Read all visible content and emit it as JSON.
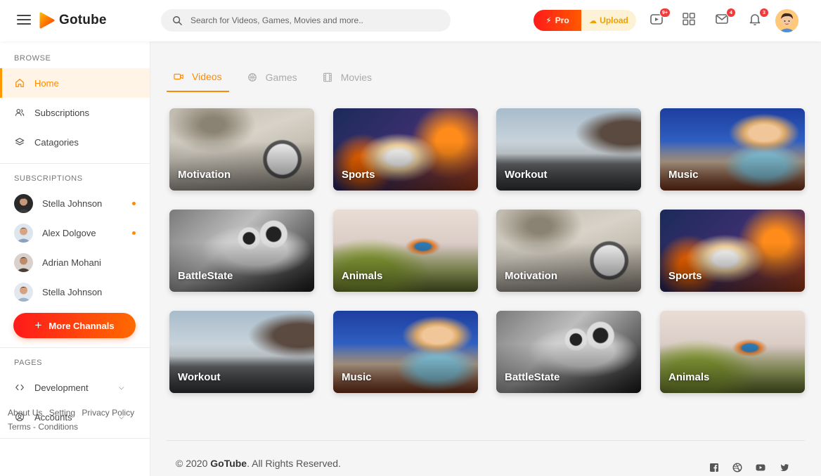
{
  "header": {
    "logo_text": "Gotube",
    "search_placeholder": "Search for Videos, Games, Movies and more..",
    "pro_label": "Pro",
    "upload_label": "Upload",
    "badges": {
      "video": "9+",
      "mail": "4",
      "notifications": "3"
    }
  },
  "sidebar": {
    "browse_title": "BROWSE",
    "browse": [
      {
        "label": "Home",
        "icon": "home-icon"
      },
      {
        "label": "Subscriptions",
        "icon": "users-icon"
      },
      {
        "label": "Catagories",
        "icon": "layers-icon"
      }
    ],
    "subscriptions_title": "SUBSCRIPTIONS",
    "subscriptions": [
      {
        "name": "Stella Johnson",
        "has_dot": true
      },
      {
        "name": "Alex Dolgove",
        "has_dot": true
      },
      {
        "name": "Adrian Mohani",
        "has_dot": false
      },
      {
        "name": "Stella Johnson",
        "has_dot": false
      }
    ],
    "more_label": "More Channals",
    "pages_title": "PAGES",
    "pages": [
      {
        "label": "Development",
        "icon": "code-icon"
      },
      {
        "label": "Accounts",
        "icon": "account-circle-icon"
      }
    ],
    "footer_links": [
      "About Us",
      "Setting",
      "Privacy Policy",
      "Terms - Conditions"
    ]
  },
  "tabs": [
    {
      "label": "Videos",
      "icon": "video-camera-icon",
      "active": true
    },
    {
      "label": "Games",
      "icon": "basketball-icon",
      "active": false
    },
    {
      "label": "Movies",
      "icon": "film-icon",
      "active": false
    }
  ],
  "cards": [
    {
      "label": "Motivation",
      "theme": "motivation"
    },
    {
      "label": "Sports",
      "theme": "sports"
    },
    {
      "label": "Workout",
      "theme": "workout"
    },
    {
      "label": "Music",
      "theme": "music"
    },
    {
      "label": "BattleState",
      "theme": "battlestate"
    },
    {
      "label": "Animals",
      "theme": "animals"
    },
    {
      "label": "Motivation",
      "theme": "motivation"
    },
    {
      "label": "Sports",
      "theme": "sports"
    },
    {
      "label": "Workout",
      "theme": "workout"
    },
    {
      "label": "Music",
      "theme": "music"
    },
    {
      "label": "BattleState",
      "theme": "battlestate"
    },
    {
      "label": "Animals",
      "theme": "animals"
    }
  ],
  "footer": {
    "copyright_prefix": "© 2020 ",
    "brand": "GoTube",
    "copyright_suffix": ". All Rights Reserved."
  },
  "colors": {
    "accent": "#ff8a00",
    "gradient_start": "#ff1a1a",
    "gradient_end": "#ff6a00"
  }
}
